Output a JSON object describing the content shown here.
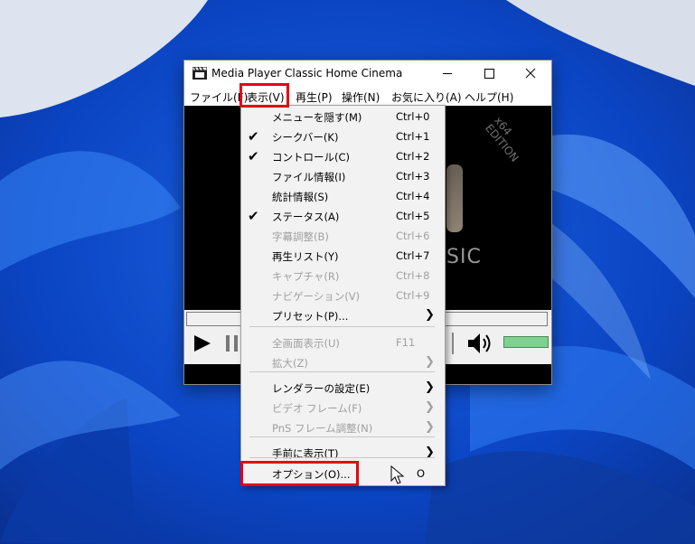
{
  "window": {
    "title": "Media Player Classic Home Cinema",
    "edition_text": "x64\nEDITION",
    "logo_partial_text": "SIC"
  },
  "menubar": [
    "ファイル(F)",
    "表示(V)",
    "再生(P)",
    "操作(N)",
    "お気に入り(A)",
    "ヘルプ(H)"
  ],
  "view_menu": {
    "items": [
      {
        "label": "メニューを隠す(M)",
        "shortcut": "Ctrl+0"
      },
      {
        "label": "シークバー(K)",
        "shortcut": "Ctrl+1",
        "checked": true
      },
      {
        "label": "コントロール(C)",
        "shortcut": "Ctrl+2",
        "checked": true
      },
      {
        "label": "ファイル情報(I)",
        "shortcut": "Ctrl+3"
      },
      {
        "label": "統計情報(S)",
        "shortcut": "Ctrl+4"
      },
      {
        "label": "ステータス(A)",
        "shortcut": "Ctrl+5",
        "checked": true
      },
      {
        "label": "字幕調整(B)",
        "shortcut": "Ctrl+6",
        "disabled": true
      },
      {
        "label": "再生リスト(Y)",
        "shortcut": "Ctrl+7"
      },
      {
        "label": "キャプチャ(R)",
        "shortcut": "Ctrl+8",
        "disabled": true
      },
      {
        "label": "ナビゲーション(V)",
        "shortcut": "Ctrl+9",
        "disabled": true
      },
      {
        "label": "プリセット(P)...",
        "submenu": true
      },
      {
        "label": "全画面表示(U)",
        "shortcut": "F11",
        "disabled": true
      },
      {
        "label": "拡大(Z)",
        "submenu": true,
        "disabled": true
      },
      {
        "label": "レンダラーの設定(E)",
        "submenu": true
      },
      {
        "label": "ビデオ フレーム(F)",
        "submenu": true,
        "disabled": true
      },
      {
        "label": "PnS フレーム調整(N)",
        "submenu": true,
        "disabled": true
      },
      {
        "label": "手前に表示(T)",
        "submenu": true
      },
      {
        "label": "オプション(O)...",
        "shortcut": "O"
      }
    ]
  },
  "check_mark": "✔",
  "submenu_arrow": "❯",
  "colors": {
    "highlight": "#e60012",
    "volume": "#7fd18f",
    "disabled_text": "#a0a0a0"
  }
}
